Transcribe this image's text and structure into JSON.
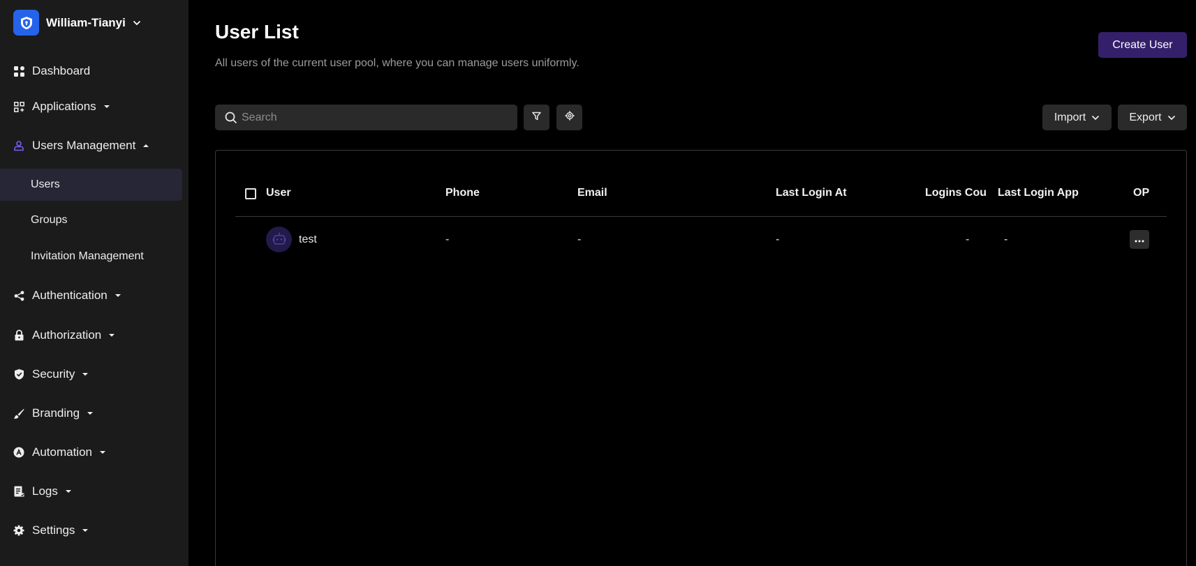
{
  "sidebar": {
    "org_name": "William-Tianyi",
    "items": [
      {
        "label": "Dashboard",
        "icon": "dashboard-icon"
      },
      {
        "label": "Applications",
        "icon": "applications-icon",
        "expandable": true
      },
      {
        "label": "Users Management",
        "icon": "users-management-icon",
        "expanded": true
      },
      {
        "label": "Authentication",
        "icon": "authentication-icon",
        "expandable": true
      },
      {
        "label": "Authorization",
        "icon": "lock-icon",
        "expandable": true
      },
      {
        "label": "Security",
        "icon": "shield-icon",
        "expandable": true
      },
      {
        "label": "Branding",
        "icon": "brush-icon",
        "expandable": true
      },
      {
        "label": "Automation",
        "icon": "automation-icon",
        "expandable": true
      },
      {
        "label": "Logs",
        "icon": "logs-icon",
        "expandable": true
      },
      {
        "label": "Settings",
        "icon": "gear-icon",
        "expandable": true
      }
    ],
    "sub_items": [
      {
        "label": "Users",
        "active": true
      },
      {
        "label": "Groups"
      },
      {
        "label": "Invitation Management"
      }
    ]
  },
  "main": {
    "title": "User List",
    "description": "All users of the current user pool, where you can manage users uniformly.",
    "create_button": "Create User",
    "search": {
      "placeholder": "Search",
      "value": ""
    },
    "import_button": "Import",
    "export_button": "Export",
    "table": {
      "columns": [
        "User",
        "Phone",
        "Email",
        "Last Login At",
        "Logins Cou",
        "Last Login App",
        "OP"
      ],
      "rows": [
        {
          "user": "test",
          "phone": "-",
          "email": "-",
          "last_login_at": "-",
          "logins_count": "-",
          "last_login_app": "-"
        }
      ]
    }
  },
  "colors": {
    "sidebar_bg": "#1b1b1b",
    "active_item_bg": "#262636",
    "brand_blue": "#2563eb",
    "primary_button": "#34206a",
    "accent_purple": "#7c5cff",
    "avatar_bg": "#221a48"
  }
}
